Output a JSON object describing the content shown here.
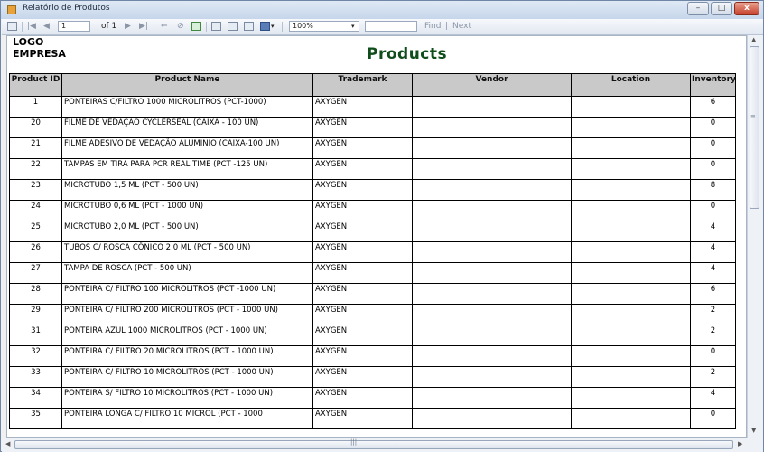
{
  "window": {
    "title": "Relatório de Produtos"
  },
  "toolbar": {
    "page_value": "1",
    "page_of": "of 1",
    "zoom_value": "100%",
    "find_label": "Find",
    "separator": "|",
    "next_label": "Next"
  },
  "report": {
    "logo_line1": "LOGO",
    "logo_line2": "EMPRESA",
    "title": "Products",
    "columns": [
      "Product ID",
      "Product Name",
      "Trademark",
      "Vendor",
      "Location",
      "Inventory"
    ],
    "rows": [
      {
        "id": "1",
        "name": "PONTEIRAS C/FILTRO 1000 MICROLITROS (PCT-1000)",
        "trademark": "AXYGEN",
        "vendor": "",
        "location": "",
        "inventory": "6"
      },
      {
        "id": "20",
        "name": "FILME DE VEDAÇÃO CYCLERSEAL (CAIXA - 100 UN)",
        "trademark": "AXYGEN",
        "vendor": "",
        "location": "",
        "inventory": "0"
      },
      {
        "id": "21",
        "name": "FILME ADESIVO DE VEDAÇÃO ALUMINIO (CAIXA-100 UN)",
        "trademark": "AXYGEN",
        "vendor": "",
        "location": "",
        "inventory": "0"
      },
      {
        "id": "22",
        "name": "TAMPAS EM TIRA PARA PCR REAL TIME (PCT -125 UN)",
        "trademark": "AXYGEN",
        "vendor": "",
        "location": "",
        "inventory": "0"
      },
      {
        "id": "23",
        "name": "MICROTUBO 1,5 ML (PCT - 500 UN)",
        "trademark": "AXYGEN",
        "vendor": "",
        "location": "",
        "inventory": "8"
      },
      {
        "id": "24",
        "name": "MICROTUBO 0,6 ML (PCT - 1000 UN)",
        "trademark": "AXYGEN",
        "vendor": "",
        "location": "",
        "inventory": "0"
      },
      {
        "id": "25",
        "name": "MICROTUBO 2,0 ML (PCT - 500 UN)",
        "trademark": "AXYGEN",
        "vendor": "",
        "location": "",
        "inventory": "4"
      },
      {
        "id": "26",
        "name": "TUBOS C/ ROSCA CÔNICO 2,0 ML (PCT - 500 UN)",
        "trademark": "AXYGEN",
        "vendor": "",
        "location": "",
        "inventory": "4"
      },
      {
        "id": "27",
        "name": "TAMPA DE ROSCA (PCT - 500 UN)",
        "trademark": "AXYGEN",
        "vendor": "",
        "location": "",
        "inventory": "4"
      },
      {
        "id": "28",
        "name": "PONTEIRA C/ FILTRO 100 MICROLITROS (PCT -1000 UN)",
        "trademark": "AXYGEN",
        "vendor": "",
        "location": "",
        "inventory": "6"
      },
      {
        "id": "29",
        "name": "PONTEIRA C/ FILTRO 200 MICROLITROS (PCT - 1000 UN)",
        "trademark": "AXYGEN",
        "vendor": "",
        "location": "",
        "inventory": "2"
      },
      {
        "id": "31",
        "name": "PONTEIRA AZUL 1000 MICROLITROS (PCT - 1000 UN)",
        "trademark": "AXYGEN",
        "vendor": "",
        "location": "",
        "inventory": "2"
      },
      {
        "id": "32",
        "name": "PONTEIRA C/ FILTRO 20 MICROLITROS (PCT - 1000 UN)",
        "trademark": "AXYGEN",
        "vendor": "",
        "location": "",
        "inventory": "0"
      },
      {
        "id": "33",
        "name": "PONTEIRA C/ FILTRO 10 MICROLITROS (PCT - 1000 UN)",
        "trademark": "AXYGEN",
        "vendor": "",
        "location": "",
        "inventory": "2"
      },
      {
        "id": "34",
        "name": "PONTEIRA S/ FILTRO 10 MICROLITROS (PCT - 1000 UN)",
        "trademark": "AXYGEN",
        "vendor": "",
        "location": "",
        "inventory": "4"
      },
      {
        "id": "35",
        "name": "PONTEIRA LONGA C/ FILTRO 10 MICROL (PCT - 1000",
        "trademark": "AXYGEN",
        "vendor": "",
        "location": "",
        "inventory": "0"
      }
    ]
  },
  "icons": {
    "window": "report-app-icon",
    "toolbar": [
      "document-map-icon",
      "first-page-icon",
      "previous-page-icon",
      "next-page-icon",
      "last-page-icon",
      "back-icon",
      "stop-icon",
      "refresh-icon",
      "print-icon",
      "print-layout-icon",
      "page-setup-icon",
      "export-icon"
    ]
  }
}
